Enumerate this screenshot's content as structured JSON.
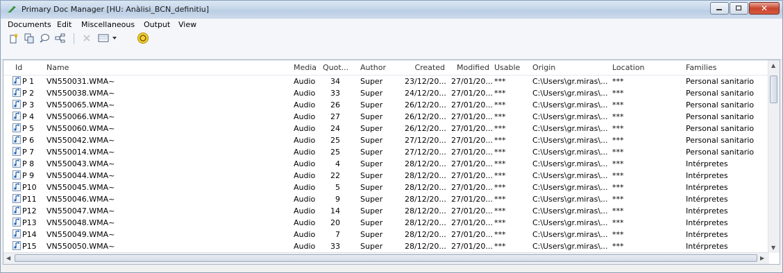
{
  "window": {
    "title": "Primary Doc Manager [HU: Anàlisi_BCN_definitiu]"
  },
  "menu": [
    "Documents",
    "Edit",
    "Miscellaneous",
    "Output",
    "View"
  ],
  "toolbar": {
    "icons": [
      "new-document-icon",
      "copy-document-icon",
      "comment-icon",
      "network-icon",
      "delete-icon",
      "view-dropdown-icon",
      "family-filter-icon"
    ]
  },
  "columns": [
    "Id",
    "Name",
    "Media",
    "Quot...",
    "Author",
    "Created",
    "Modified",
    "Usable",
    "Origin",
    "Location",
    "Families"
  ],
  "rows": [
    {
      "id": "P 1",
      "name": "VN550031.WMA~",
      "media": "Audio",
      "quot": "34",
      "author": "Super",
      "created": "23/12/20...",
      "modified": "27/01/20...",
      "usable": "***",
      "origin": "C:\\Users\\gr.miras\\...",
      "location": "***",
      "families": "Personal sanitario"
    },
    {
      "id": "P 2",
      "name": "VN550038.WMA~",
      "media": "Audio",
      "quot": "33",
      "author": "Super",
      "created": "24/12/20...",
      "modified": "27/01/20...",
      "usable": "***",
      "origin": "C:\\Users\\gr.miras\\...",
      "location": "***",
      "families": "Personal sanitario"
    },
    {
      "id": "P 3",
      "name": "VN550065.WMA~",
      "media": "Audio",
      "quot": "26",
      "author": "Super",
      "created": "26/12/20...",
      "modified": "27/01/20...",
      "usable": "***",
      "origin": "C:\\Users\\gr.miras\\...",
      "location": "***",
      "families": "Personal sanitario"
    },
    {
      "id": "P 4",
      "name": "VN550066.WMA~",
      "media": "Audio",
      "quot": "27",
      "author": "Super",
      "created": "26/12/20...",
      "modified": "27/01/20...",
      "usable": "***",
      "origin": "C:\\Users\\gr.miras\\...",
      "location": "***",
      "families": "Personal sanitario"
    },
    {
      "id": "P 5",
      "name": "VN550060.WMA~",
      "media": "Audio",
      "quot": "24",
      "author": "Super",
      "created": "26/12/20...",
      "modified": "27/01/20...",
      "usable": "***",
      "origin": "C:\\Users\\gr.miras\\...",
      "location": "***",
      "families": "Personal sanitario"
    },
    {
      "id": "P 6",
      "name": "VN550042.WMA~",
      "media": "Audio",
      "quot": "25",
      "author": "Super",
      "created": "27/12/20...",
      "modified": "27/01/20...",
      "usable": "***",
      "origin": "C:\\Users\\gr.miras\\...",
      "location": "***",
      "families": "Personal sanitario"
    },
    {
      "id": "P 7",
      "name": "VN550014.WMA~",
      "media": "Audio",
      "quot": "25",
      "author": "Super",
      "created": "27/12/20...",
      "modified": "27/01/20...",
      "usable": "***",
      "origin": "C:\\Users\\gr.miras\\...",
      "location": "***",
      "families": "Personal sanitario"
    },
    {
      "id": "P 8",
      "name": "VN550043.WMA~",
      "media": "Audio",
      "quot": "4",
      "author": "Super",
      "created": "28/12/20...",
      "modified": "27/01/20...",
      "usable": "***",
      "origin": "C:\\Users\\gr.miras\\...",
      "location": "***",
      "families": "Intérpretes"
    },
    {
      "id": "P 9",
      "name": "VN550044.WMA~",
      "media": "Audio",
      "quot": "22",
      "author": "Super",
      "created": "28/12/20...",
      "modified": "27/01/20...",
      "usable": "***",
      "origin": "C:\\Users\\gr.miras\\...",
      "location": "***",
      "families": "Intérpretes"
    },
    {
      "id": "P10",
      "name": "VN550045.WMA~",
      "media": "Audio",
      "quot": "5",
      "author": "Super",
      "created": "28/12/20...",
      "modified": "27/01/20...",
      "usable": "***",
      "origin": "C:\\Users\\gr.miras\\...",
      "location": "***",
      "families": "Intérpretes"
    },
    {
      "id": "P11",
      "name": "VN550046.WMA~",
      "media": "Audio",
      "quot": "9",
      "author": "Super",
      "created": "28/12/20...",
      "modified": "27/01/20...",
      "usable": "***",
      "origin": "C:\\Users\\gr.miras\\...",
      "location": "***",
      "families": "Intérpretes"
    },
    {
      "id": "P12",
      "name": "VN550047.WMA~",
      "media": "Audio",
      "quot": "14",
      "author": "Super",
      "created": "28/12/20...",
      "modified": "27/01/20...",
      "usable": "***",
      "origin": "C:\\Users\\gr.miras\\...",
      "location": "***",
      "families": "Intérpretes"
    },
    {
      "id": "P13",
      "name": "VN550048.WMA~",
      "media": "Audio",
      "quot": "20",
      "author": "Super",
      "created": "28/12/20...",
      "modified": "27/01/20...",
      "usable": "***",
      "origin": "C:\\Users\\gr.miras\\...",
      "location": "***",
      "families": "Intérpretes"
    },
    {
      "id": "P14",
      "name": "VN550049.WMA~",
      "media": "Audio",
      "quot": "7",
      "author": "Super",
      "created": "28/12/20...",
      "modified": "27/01/20...",
      "usable": "***",
      "origin": "C:\\Users\\gr.miras\\...",
      "location": "***",
      "families": "Intérpretes"
    },
    {
      "id": "P15",
      "name": "VN550050.WMA~",
      "media": "Audio",
      "quot": "33",
      "author": "Super",
      "created": "28/12/20...",
      "modified": "27/01/20...",
      "usable": "***",
      "origin": "C:\\Users\\gr.miras\\...",
      "location": "***",
      "families": "Intérpretes"
    }
  ]
}
